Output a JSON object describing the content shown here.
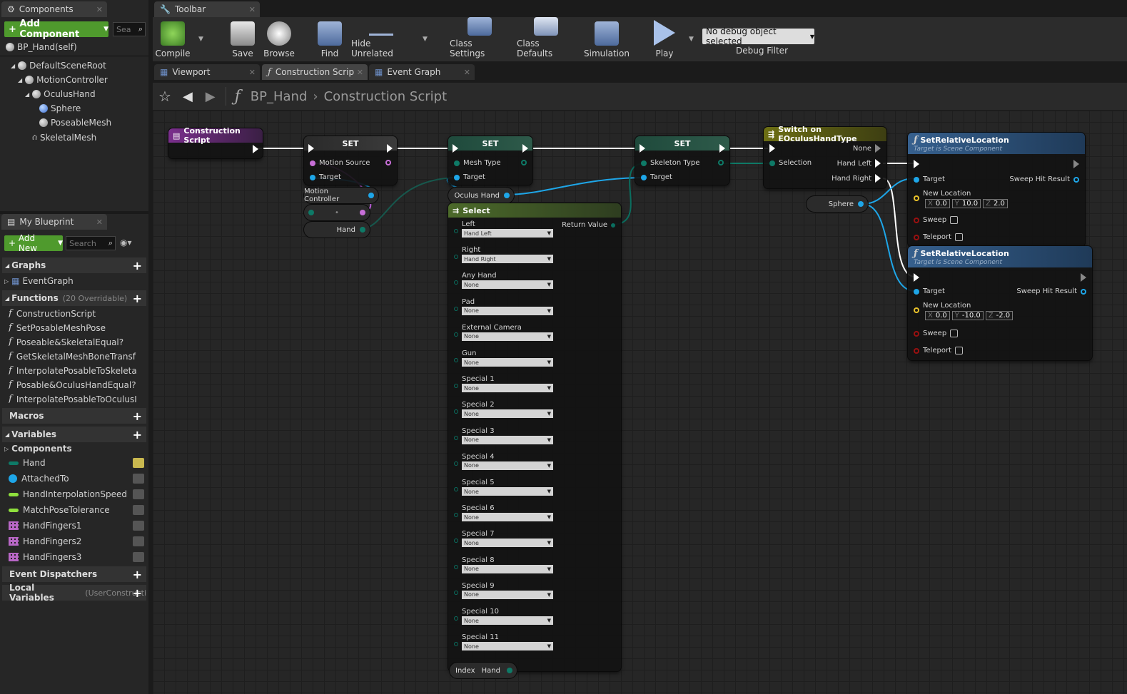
{
  "left": {
    "components_tab": "Components",
    "add_component": "Add Component",
    "search_placeholder": "Sea",
    "self_item": "BP_Hand(self)",
    "tree": [
      "DefaultSceneRoot",
      "MotionController",
      "OculusHand",
      "Sphere",
      "PoseableMesh",
      "SkeletalMesh"
    ],
    "my_blueprint_tab": "My Blueprint",
    "add_new": "Add New",
    "search2_placeholder": "Search",
    "sections": {
      "graphs": "Graphs",
      "functions": "Functions",
      "functions_sub": "(20 Overridable)",
      "macros": "Macros",
      "variables": "Variables",
      "components": "Components",
      "event_dispatchers": "Event Dispatchers",
      "local_variables": "Local Variables",
      "local_sub": "(UserConstructi"
    },
    "event_graph": "EventGraph",
    "functions": [
      "ConstructionScript",
      "SetPosableMeshPose",
      "Poseable&SkeletalEqual?",
      "GetSkeletalMeshBoneTransf",
      "InterpolatePosableToSkeleta",
      "Posable&OculusHandEqual?",
      "InterpolatePosableToOculusI"
    ],
    "variables": [
      "Hand",
      "AttachedTo",
      "HandInterpolationSpeed",
      "MatchPoseTolerance",
      "HandFingers1",
      "HandFingers2",
      "HandFingers3"
    ]
  },
  "toolbar": {
    "tab": "Toolbar",
    "buttons": [
      "Compile",
      "Save",
      "Browse",
      "Find",
      "Hide Unrelated",
      "Class Settings",
      "Class Defaults",
      "Simulation",
      "Play"
    ],
    "debug_select": "No debug object selected",
    "debug_filter": "Debug Filter"
  },
  "graph_tabs": [
    "Viewport",
    "Construction Scrip",
    "Event Graph"
  ],
  "breadcrumb": {
    "blueprint": "BP_Hand",
    "graph": "Construction Script"
  },
  "nodes": {
    "construction_script": "Construction Script",
    "set1": {
      "title": "SET",
      "p1": "Motion Source",
      "p2": "Target"
    },
    "set2": {
      "title": "SET",
      "p1": "Mesh Type",
      "p2": "Target"
    },
    "set3": {
      "title": "SET",
      "p1": "Skeleton Type",
      "p2": "Target"
    },
    "motion_controller": "Motion Controller",
    "hand_var": "Hand",
    "oculus_hand": "Oculus Hand",
    "sphere": "Sphere",
    "switch": {
      "title": "Switch on EOculusHandType",
      "none": "None",
      "left": "Hand Left",
      "right": "Hand Right",
      "selection": "Selection"
    },
    "select": {
      "title": "Select",
      "return": "Return Value",
      "options": [
        {
          "label": "Left",
          "value": "Hand Left"
        },
        {
          "label": "Right",
          "value": "Hand Right"
        },
        {
          "label": "Any Hand",
          "value": "None"
        },
        {
          "label": "Pad",
          "value": "None"
        },
        {
          "label": "External Camera",
          "value": "None"
        },
        {
          "label": "Gun",
          "value": "None"
        },
        {
          "label": "Special 1",
          "value": "None"
        },
        {
          "label": "Special 2",
          "value": "None"
        },
        {
          "label": "Special 3",
          "value": "None"
        },
        {
          "label": "Special 4",
          "value": "None"
        },
        {
          "label": "Special 5",
          "value": "None"
        },
        {
          "label": "Special 6",
          "value": "None"
        },
        {
          "label": "Special 7",
          "value": "None"
        },
        {
          "label": "Special 8",
          "value": "None"
        },
        {
          "label": "Special 9",
          "value": "None"
        },
        {
          "label": "Special 10",
          "value": "None"
        },
        {
          "label": "Special 11",
          "value": "None"
        }
      ],
      "index": "Index",
      "index_var": "Hand"
    },
    "srl1": {
      "title": "SetRelativeLocation",
      "sub": "Target is Scene Component",
      "target": "Target",
      "sweep_hit": "Sweep Hit Result",
      "new_loc": "New Location",
      "x": "0.0",
      "y": "10.0",
      "z": "2.0",
      "sweep": "Sweep",
      "teleport": "Teleport"
    },
    "srl2": {
      "title": "SetRelativeLocation",
      "sub": "Target is Scene Component",
      "target": "Target",
      "sweep_hit": "Sweep Hit Result",
      "new_loc": "New Location",
      "x": "0.0",
      "y": "-10.0",
      "z": "-2.0",
      "sweep": "Sweep",
      "teleport": "Teleport"
    }
  },
  "colors": {
    "object_pin": "#1ea6e8",
    "enum_pin": "#0e7a67",
    "byte_pin": "#0a6e5f",
    "struct_pin": "#b35ad0",
    "vector_pin": "#e9c22a",
    "bool_pin": "#9a1010",
    "compile_green": "#4f9a2d"
  }
}
